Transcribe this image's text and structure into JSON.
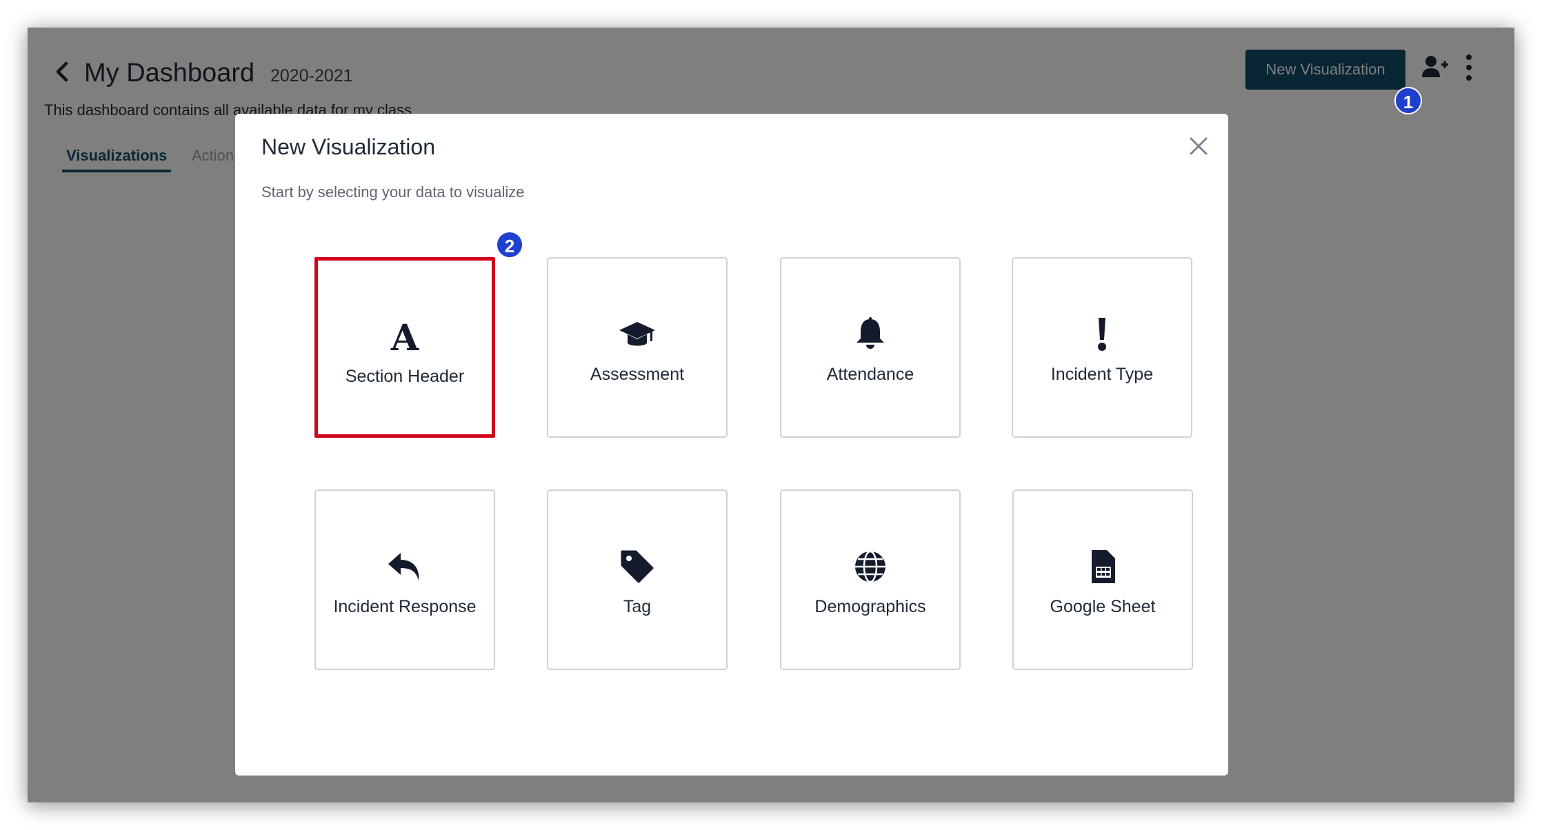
{
  "header": {
    "back_icon": "chevron-left-icon",
    "title": "My Dashboard",
    "year": "2020-2021",
    "description": "This dashboard contains all available data for my class",
    "new_visualization_label": "New Visualization",
    "add_user_icon": "user-plus-icon",
    "menu_icon": "kebab-menu-icon"
  },
  "tabs": [
    {
      "label": "Visualizations",
      "active": true
    },
    {
      "label": "Action",
      "active": false
    }
  ],
  "annotations": {
    "step1": "1",
    "step2": "2"
  },
  "modal": {
    "title": "New Visualization",
    "subtitle": "Start by selecting your data to visualize",
    "close_icon": "close-icon",
    "options": [
      {
        "label": "Section Header",
        "icon": "letter-a-icon",
        "selected": true
      },
      {
        "label": "Assessment",
        "icon": "graduation-cap-icon",
        "selected": false
      },
      {
        "label": "Attendance",
        "icon": "bell-icon",
        "selected": false
      },
      {
        "label": "Incident Type",
        "icon": "exclamation-icon",
        "selected": false
      },
      {
        "label": "Incident Response",
        "icon": "reply-arrow-icon",
        "selected": false
      },
      {
        "label": "Tag",
        "icon": "tag-icon",
        "selected": false
      },
      {
        "label": "Demographics",
        "icon": "globe-icon",
        "selected": false
      },
      {
        "label": "Google Sheet",
        "icon": "spreadsheet-icon",
        "selected": false
      }
    ]
  },
  "colors": {
    "primary": "#0f4a66",
    "badge": "#1f3fce",
    "highlight": "#d0021b"
  }
}
